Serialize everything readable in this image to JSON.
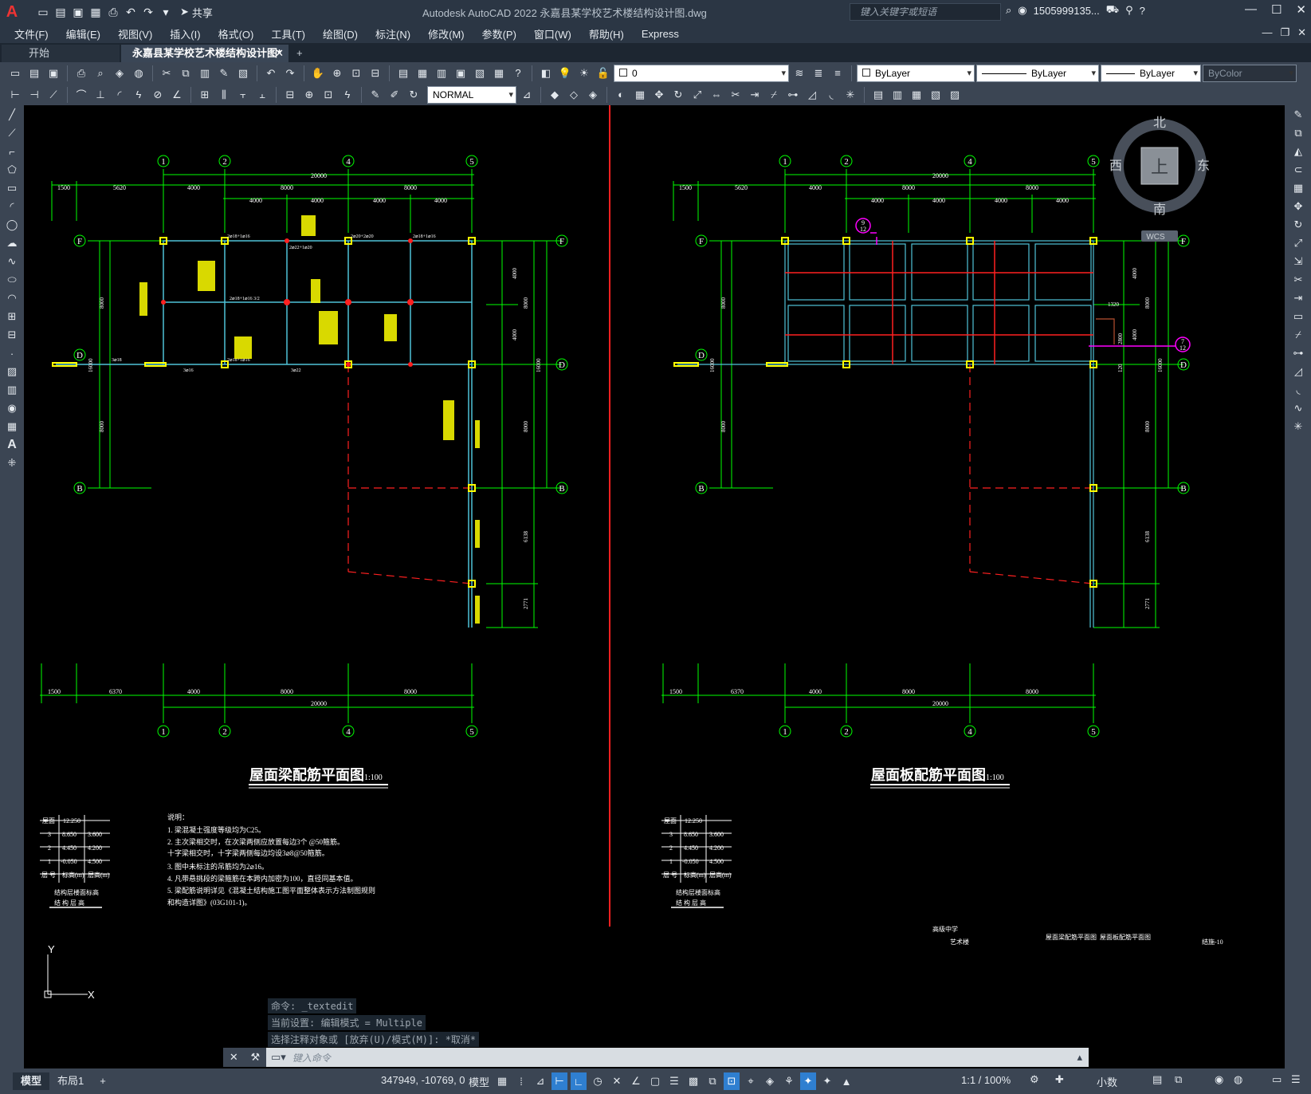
{
  "app": {
    "title": "Autodesk AutoCAD 2022    永嘉县某学校艺术楼结构设计图.dwg",
    "share_label": "共享",
    "search_placeholder": "键入关键字或短语",
    "user": "1505999135...",
    "logo": "A"
  },
  "menu": [
    "文件(F)",
    "编辑(E)",
    "视图(V)",
    "插入(I)",
    "格式(O)",
    "工具(T)",
    "绘图(D)",
    "标注(N)",
    "修改(M)",
    "参数(P)",
    "窗口(W)",
    "帮助(H)",
    "Express"
  ],
  "tabs": {
    "start": "开始",
    "active": "永嘉县某学校艺术楼结构设计图*",
    "close": "✕",
    "add": "+"
  },
  "layers_toolbar": {
    "layer_value": "0",
    "color": "ByLayer",
    "linetype": "ByLayer",
    "lineweight": "ByLayer",
    "plotstyle": "ByColor"
  },
  "dim_toolbar": {
    "dimstyle": "NORMAL"
  },
  "viewcube": {
    "north": "北",
    "south": "南",
    "east": "东",
    "west": "西",
    "top": "上",
    "wcs": "WCS"
  },
  "drawing": {
    "left_title": "屋面梁配筋平面图",
    "right_title": "屋面板配筋平面图",
    "scale": "1:100",
    "axes_top": [
      "1",
      "2",
      "4",
      "5"
    ],
    "axes_side": [
      "F",
      "D",
      "B"
    ],
    "dims_top_row1": [
      "1500",
      "5620",
      "4000",
      "8000",
      "8000"
    ],
    "dims_top_total": "20000",
    "dims_top_row2": [
      "4000",
      "4000",
      "4000",
      "4000"
    ],
    "dims_bottom_row": [
      "1500",
      "6370",
      "4000",
      "8000",
      "8000"
    ],
    "dims_bottom_total": "20000",
    "dims_left": [
      "8000",
      "16000",
      "8000"
    ],
    "dims_right": [
      "4000",
      "8000",
      "4000",
      "16000",
      "8000",
      "6138",
      "2771"
    ],
    "beam_labels": [
      "2⌀18+1⌀16",
      "2⌀20+2⌀20",
      "2⌀18+1⌀16",
      "2⌀22+1⌀20",
      "2⌀18+1⌀16 3/2",
      "2⌀18+1⌀16",
      "3⌀18",
      "3⌀16",
      "3⌀22"
    ],
    "balloon_9": "9",
    "balloon_12": "12",
    "balloon_7": "7",
    "slab_dims": [
      "1320",
      "2800",
      "120"
    ],
    "level_table": {
      "header": [
        "屋面",
        "12.250"
      ],
      "rows": [
        [
          "3",
          "8.650",
          "3.600"
        ],
        [
          "2",
          "4.450",
          "4.200"
        ],
        [
          "1",
          "-0.050",
          "4.500"
        ]
      ],
      "footer": [
        "层 号",
        "标高(m)",
        "层高(m)"
      ],
      "caption_left": [
        "结构层楼面标高",
        "结 构 层 高"
      ],
      "caption_right": [
        "结构层楼面标高",
        "结 构 层 高"
      ]
    },
    "notes_title": "说明：",
    "notes": [
      "1.  梁混凝土强度等级均为C25。",
      "2.  主次梁相交时，在次梁两侧应放置每边3个  @50箍筋。",
      "     十字梁相交时，十字梁两侧每边均设3⌀8@50箍筋。",
      "3.  图中未标注的吊筋均为2⌀16。",
      "4.  凡带悬挑段的梁箍筋在本跨内加密为100，直径同基本值。",
      "5.  梁配筋说明详见《混凝土结构施工图平面整体表示方法制图规则",
      "     和构造详图》(03G101-1)。"
    ],
    "titleblock": [
      "高级中学",
      "艺术楼",
      "屋面梁配筋平面图",
      "屋面板配筋平面图",
      "结施-10"
    ]
  },
  "command": {
    "history": [
      "命令: _textedit",
      "当前设置: 编辑模式 = Multiple",
      "选择注释对象或 [放弃(U)/模式(M)]: *取消*"
    ],
    "prompt": "键入命令"
  },
  "status": {
    "model_tab": "模型",
    "layout_tab": "布局1",
    "add_tab": "+",
    "coords": "347949, -10769, 0",
    "space": "模型",
    "scale": "1:1 / 100%",
    "units": "小数"
  },
  "colors": {
    "accent": "#2f7fd0",
    "axis_green": "#00ff00",
    "column_yellow": "#ffff00",
    "beam_cyan": "#4fc3d8",
    "cut_red": "#ff2020",
    "magenta": "#ff00ff"
  }
}
